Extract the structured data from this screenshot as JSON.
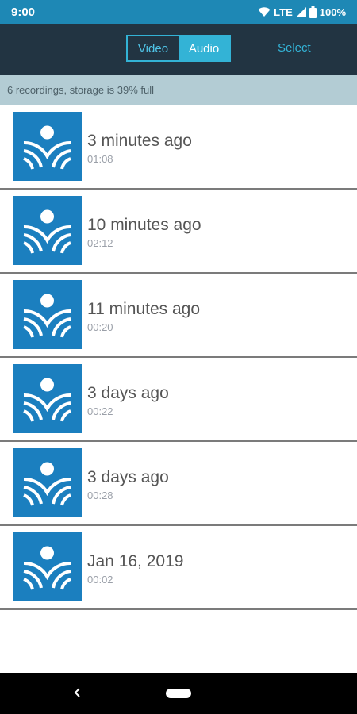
{
  "status_bar": {
    "time": "9:00",
    "network": "LTE",
    "battery": "100%"
  },
  "toolbar": {
    "segment_video": "Video",
    "segment_audio": "Audio",
    "selected_segment": "Audio",
    "select_label": "Select"
  },
  "storage_info": "6 recordings, storage is 39% full",
  "recordings": [
    {
      "title": "3 minutes ago",
      "duration": "01:08"
    },
    {
      "title": "10 minutes ago",
      "duration": "02:12"
    },
    {
      "title": "11 minutes ago",
      "duration": "00:20"
    },
    {
      "title": "3 days ago",
      "duration": "00:22"
    },
    {
      "title": "3 days ago",
      "duration": "00:28"
    },
    {
      "title": "Jan 16, 2019",
      "duration": "00:02"
    }
  ],
  "icons": {
    "thumbnail": "recording-logo-icon",
    "nav_back": "back-icon",
    "nav_home": "home-pill"
  },
  "colors": {
    "status_bar": "#1e88b5",
    "app_bar": "#223442",
    "accent": "#33b3d6",
    "storage_bar": "#b3ccd4",
    "thumbnail": "#1b7fbf"
  }
}
